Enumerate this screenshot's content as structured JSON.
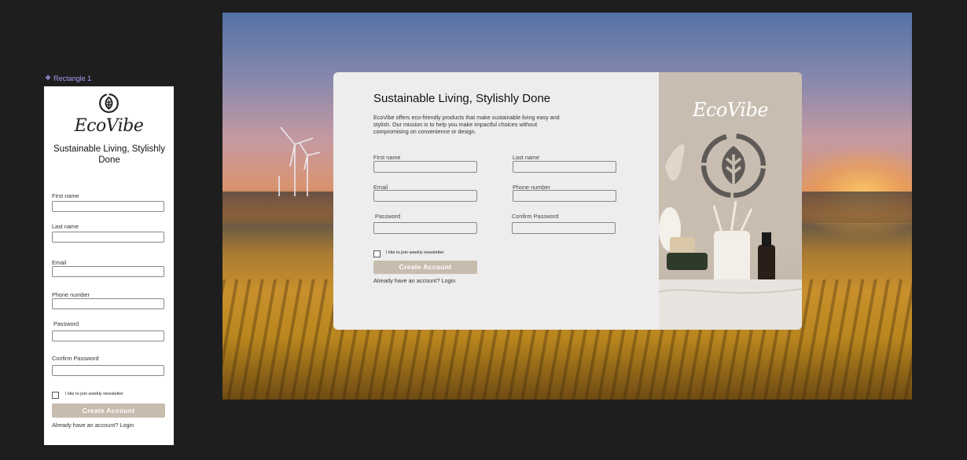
{
  "frame": {
    "label": "Rectangle 1"
  },
  "brand": "EcoVibe",
  "headline": "Sustainable Living, Stylishly Done",
  "description": "EcoVibe offers eco-friendly products that make sustainable living easy and stylish. Our mission is to help you make impactful choices without compromising on convenience or design.",
  "fields": {
    "first_name": "First name",
    "last_name": "Last name",
    "email": "Email",
    "phone": "Phone number",
    "password": "Password",
    "confirm_password": "Confirm Password"
  },
  "newsletter_label": "I like to join weekly newsletter",
  "create_button": "Create Account",
  "login_text": "Already have an account? Login",
  "colors": {
    "canvas": "#1e1e1e",
    "button": "#c8bcae",
    "card": "#ededed",
    "frame_label": "#a89bf2"
  },
  "icons": [
    "leaf-recycle-logo-icon",
    "component-diamond-icon"
  ]
}
